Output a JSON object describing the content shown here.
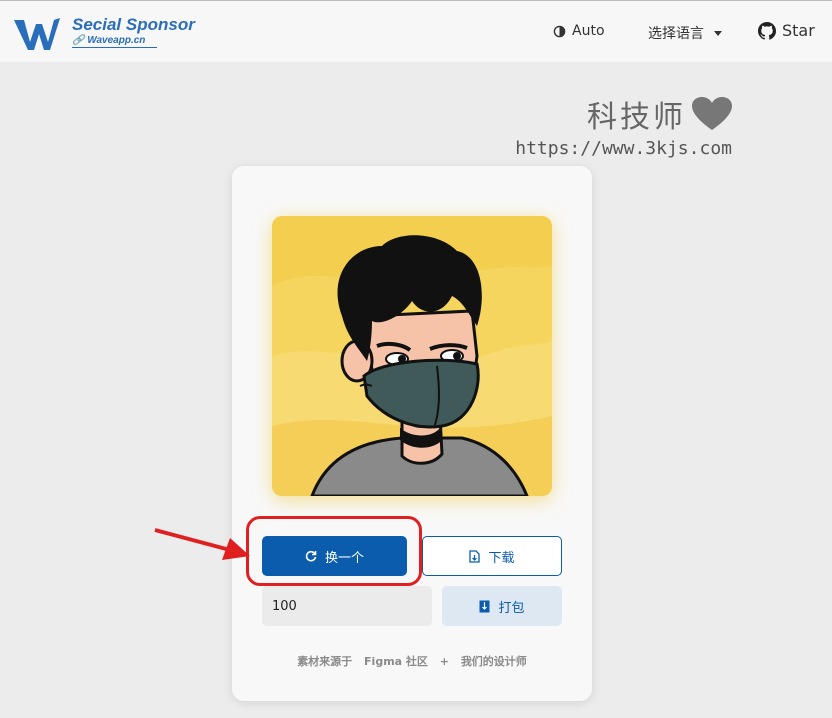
{
  "header": {
    "brand_title": "Secial Sponsor",
    "brand_subtitle": "Waveapp.cn",
    "theme_label": "Auto",
    "language_label": "选择语言",
    "github_label": "Star"
  },
  "watermark": {
    "title": "科技师",
    "url": "https://www.3kjs.com"
  },
  "card": {
    "change_label": "换一个",
    "download_label": "下载",
    "count_value": "100",
    "pack_label": "打包",
    "credits": {
      "prefix": "素材来源于",
      "source": "Figma 社区",
      "plus": "+",
      "designer": "我们的设计师"
    }
  },
  "colors": {
    "accent": "#0b5cad",
    "annotation": "#e02020",
    "avatar_bg": "#f4cf4f"
  }
}
